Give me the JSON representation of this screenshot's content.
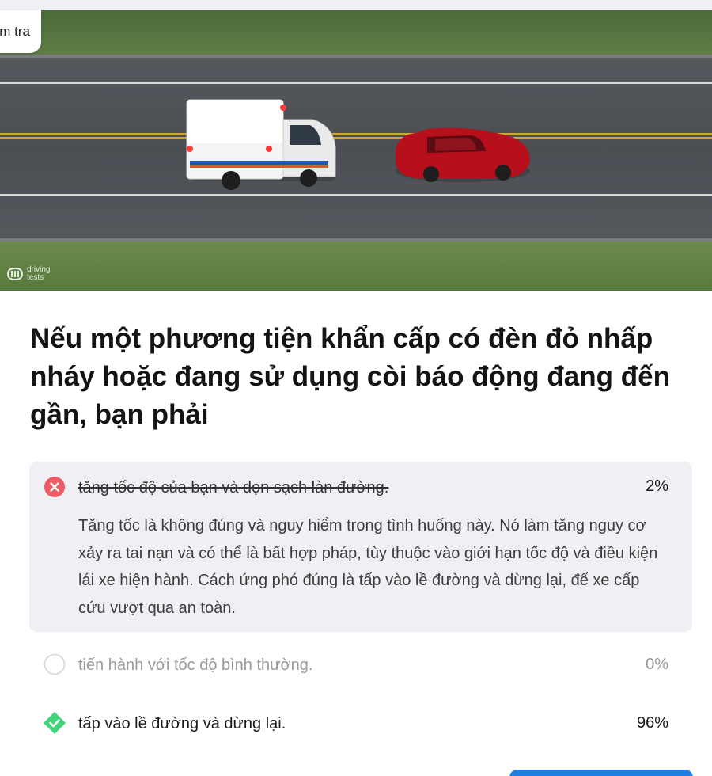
{
  "header": {
    "back_label": "m tra"
  },
  "hero": {
    "watermark_text": "driving tests"
  },
  "question": {
    "text": "Nếu một phương tiện khẩn cấp có đèn đỏ nhấp nháy hoặc đang sử dụng còi báo động đang đến gần, bạn phải"
  },
  "answers": [
    {
      "label": "tăng tốc độ của bạn và dọn sạch làn đường.",
      "percent": "2%",
      "status": "wrong",
      "explanation": "Tăng tốc là không đúng và nguy hiểm trong tình huống này. Nó làm tăng nguy cơ xảy ra tai nạn và có thể là bất hợp pháp, tùy thuộc vào giới hạn tốc độ và điều kiện lái xe hiện hành. Cách ứng phó đúng là tấp vào lề đường và dừng lại, để xe cấp cứu vượt qua an toàn."
    },
    {
      "label": "tiến hành với tốc độ bình thường.",
      "percent": "0%",
      "status": "neutral"
    },
    {
      "label": "tấp vào lề đường và dừng lại.",
      "percent": "96%",
      "status": "correct"
    }
  ],
  "colors": {
    "wrong": "#ee5a66",
    "correct": "#3fd67a",
    "accent": "#1f7ee6",
    "selected_bg": "#f0f0f4"
  },
  "icons": {
    "wrong": "x-circle-icon",
    "neutral": "empty-circle-icon",
    "correct": "check-diamond-icon"
  }
}
